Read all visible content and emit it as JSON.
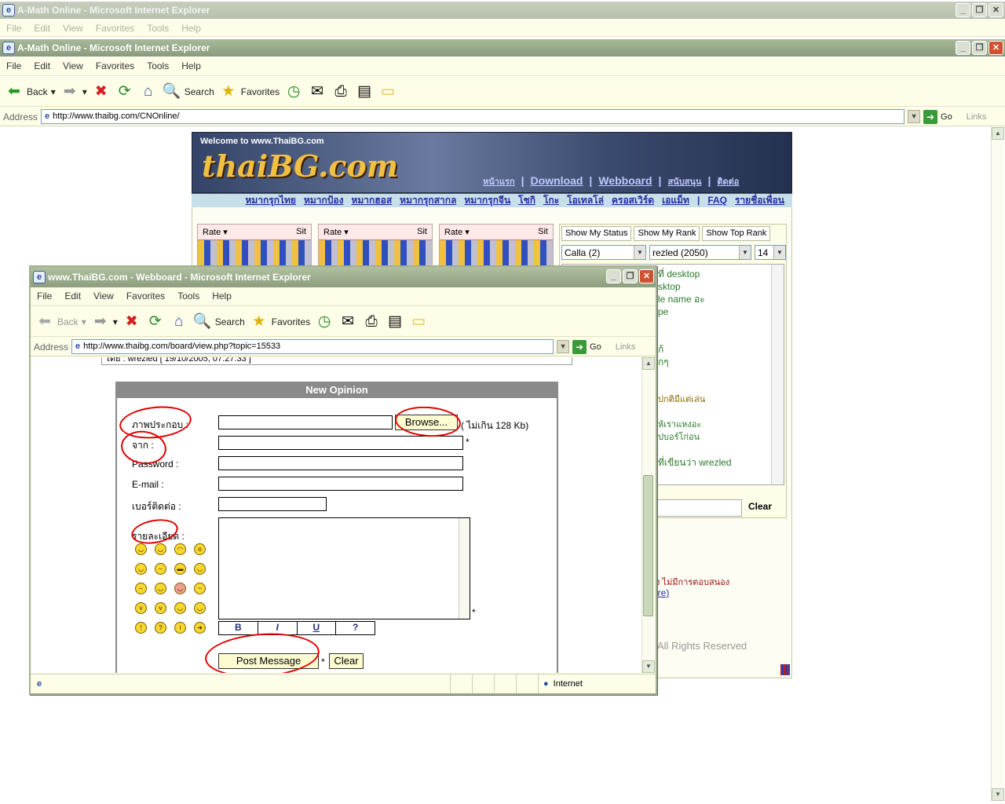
{
  "back_window": {
    "title": "A-Math Online - Microsoft Internet Explorer",
    "dim_title": "A-Math Online - Microsoft Internet Explorer",
    "menu": [
      "File",
      "Edit",
      "View",
      "Favorites",
      "Tools",
      "Help"
    ],
    "toolbar": {
      "back": "Back",
      "search": "Search",
      "favorites": "Favorites"
    },
    "address_label": "Address",
    "url": "http://www.thaibg.com/CNOnline/",
    "go": "Go",
    "links": "Links"
  },
  "site": {
    "welcome": "Welcome to www.ThaiBG.com",
    "logo": "thaiBG.com",
    "nav_top": [
      "หน้าแรก",
      "Download",
      "Webboard",
      "สนับสนุน",
      "ติดต่อ"
    ],
    "nav_games": [
      "หมากรุกไทย",
      "หมากป้อง",
      "หมากฮอส",
      "หมากรุกสากล",
      "หมากรุกจีน",
      "โชกิ",
      "โกะ",
      "โอเทลโล่",
      "ครอสเวิร์ด",
      "เอแม็ท"
    ],
    "faq": "FAQ",
    "friends": "รายชื่อเพื่อน",
    "rate": "Rate",
    "sit": "Sit",
    "tabs": [
      "Show My Status",
      "Show My Rank",
      "Show Top Rank"
    ],
    "select1": "Calla (2)",
    "select2": "rezled (2050)",
    "select3": "14",
    "chat_lines": [
      "ที่ desktop",
      "sktop",
      "le name อะ",
      "pe",
      "",
      "",
      "ก้",
      "กๆ",
      "",
      "",
      "ปกติมีแต่เล่น",
      "",
      "ห้เราแหงอะ",
      "ปบอร์โก่อน",
      "",
      "ที่เขียนว่า wrezled"
    ],
    "clear": "Clear",
    "note1": "ง ไม่มีการตอบสนอง",
    "note2": "ire)",
    "copyright": "All Rights Reserved"
  },
  "front_window": {
    "title": "www.ThaiBG.com - Webboard - Microsoft Internet Explorer",
    "menu": [
      "File",
      "Edit",
      "View",
      "Favorites",
      "Tools",
      "Help"
    ],
    "toolbar": {
      "back": "Back",
      "search": "Search",
      "favorites": "Favorites"
    },
    "address_label": "Address",
    "url": "http://www.thaibg.com/board/view.php?topic=15533",
    "go": "Go",
    "links": "Links",
    "prev_post": "โดย : wrezled  [ 19/10/2005, 07:27:33 ]",
    "status_zone": "Internet"
  },
  "form": {
    "header": "New Opinion",
    "image_label": "ภาพประกอบ :",
    "browse": "Browse...",
    "size_note": "( ไม่เกิน 128 Kb)",
    "from_label": "จาก :",
    "password_label": "Password :",
    "email_label": "E-mail :",
    "phone_label": "เบอร์ติดต่อ :",
    "detail_label": "รายละเอียด :",
    "required": "*",
    "fmt_bold": "B",
    "fmt_italic": "I",
    "fmt_underline": "U",
    "fmt_help": "?",
    "post": "Post Message",
    "clear": "Clear"
  }
}
